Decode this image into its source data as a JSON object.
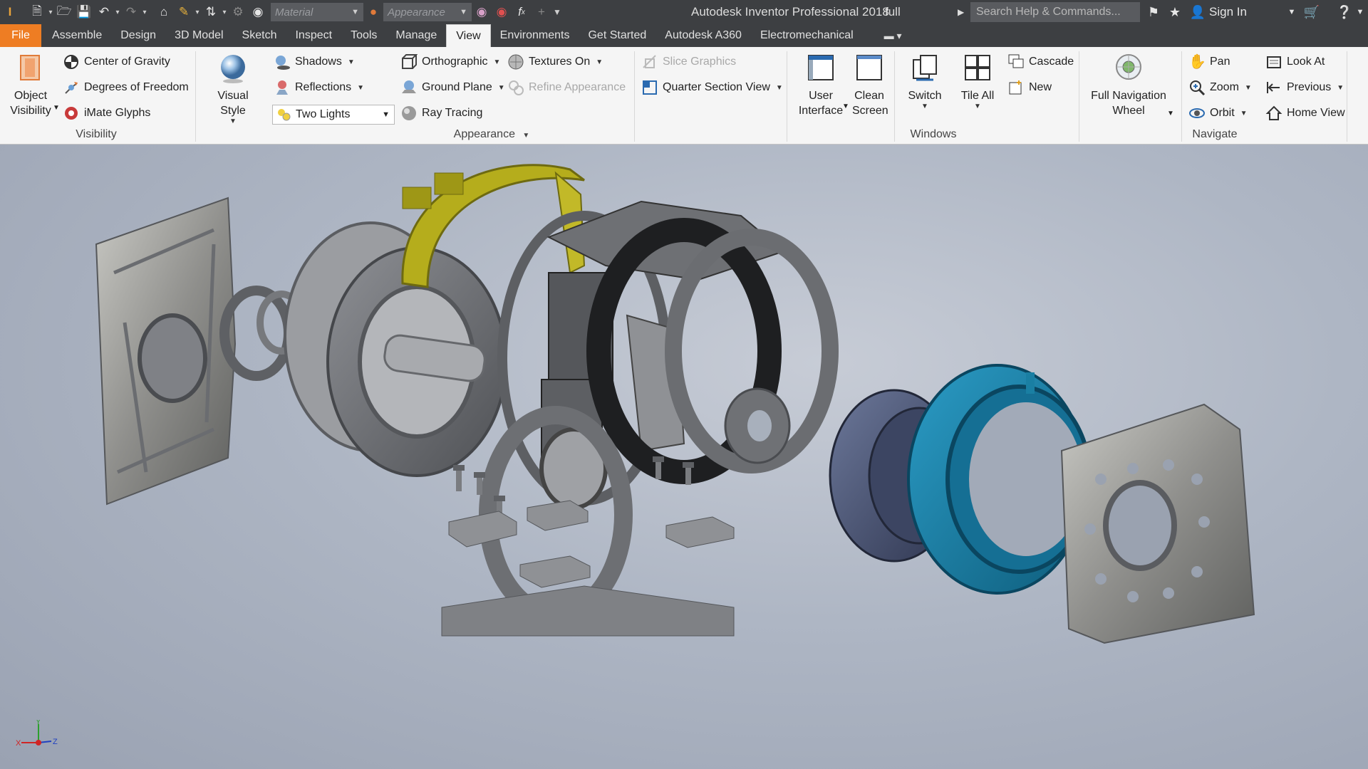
{
  "titlebar": {
    "app_title": "Autodesk Inventor Professional 2018",
    "document_name": "full",
    "search_placeholder": "Search Help & Commands...",
    "sign_in": "Sign In",
    "material_placeholder": "Material",
    "appearance_placeholder": "Appearance"
  },
  "tabs": [
    {
      "label": "File"
    },
    {
      "label": "Assemble"
    },
    {
      "label": "Design"
    },
    {
      "label": "3D Model"
    },
    {
      "label": "Sketch"
    },
    {
      "label": "Inspect"
    },
    {
      "label": "Tools"
    },
    {
      "label": "Manage"
    },
    {
      "label": "View"
    },
    {
      "label": "Environments"
    },
    {
      "label": "Get Started"
    },
    {
      "label": "Autodesk A360"
    },
    {
      "label": "Electromechanical"
    }
  ],
  "active_tab": "View",
  "ribbon": {
    "visibility": {
      "label": "Visibility",
      "object_visibility_line1": "Object",
      "object_visibility_line2": "Visibility",
      "center_of_gravity": "Center of Gravity",
      "degrees_of_freedom": "Degrees of Freedom",
      "imate_glyphs": "iMate Glyphs"
    },
    "appearance": {
      "label": "Appearance",
      "visual_style": "Visual Style",
      "shadows": "Shadows",
      "reflections": "Reflections",
      "lighting_style": "Two Lights",
      "orthographic": "Orthographic",
      "ground_plane": "Ground Plane",
      "ray_tracing": "Ray Tracing",
      "textures_on": "Textures On",
      "refine_appearance": "Refine Appearance",
      "slice_graphics": "Slice Graphics",
      "quarter_section_view": "Quarter Section View"
    },
    "windows": {
      "label": "Windows",
      "user_interface_line1": "User",
      "user_interface_line2": "Interface",
      "clean_screen_line1": "Clean",
      "clean_screen_line2": "Screen",
      "switch": "Switch",
      "tile_all": "Tile All",
      "cascade": "Cascade",
      "new": "New"
    },
    "navigate": {
      "label": "Navigate",
      "full_nav_wheel_line1": "Full Navigation",
      "full_nav_wheel_line2": "Wheel",
      "pan": "Pan",
      "zoom": "Zoom",
      "orbit": "Orbit",
      "look_at": "Look At",
      "previous": "Previous",
      "home_view": "Home View"
    }
  },
  "triad": {
    "x": "X",
    "y": "Y",
    "z": "Z"
  },
  "colors": {
    "titlebar_bg": "#3d3f42",
    "file_tab": "#ee7d23",
    "ribbon_bg": "#f5f5f5",
    "part_gray": "#8d8f93",
    "part_yellow": "#b5ad1c",
    "part_blue": "#1a7fa3",
    "part_navy": "#4a5370"
  }
}
